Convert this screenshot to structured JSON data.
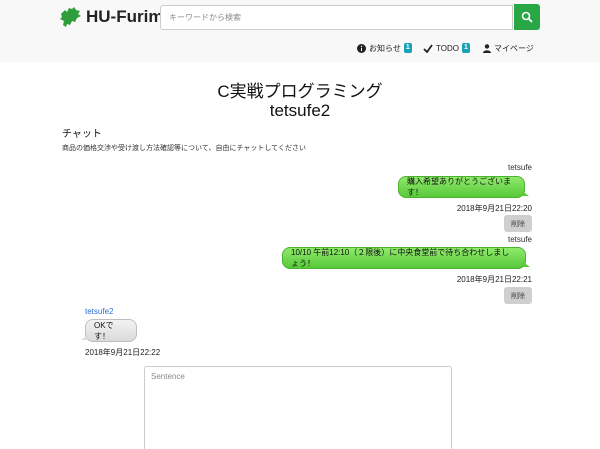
{
  "header": {
    "logo_text": "HU-Furima",
    "search": {
      "placeholder": "キーワードから検索",
      "value": ""
    },
    "nav": {
      "notice_label": "お知らせ",
      "notice_count": "1",
      "todo_label": "TODO",
      "todo_count": "1",
      "mypage_label": "マイページ"
    },
    "colors": {
      "search_button": "#28a745",
      "badge": "#17a2b8"
    }
  },
  "page": {
    "title": "C実戦プログラミング",
    "subtitle": "tetsufe2",
    "section_title": "チャット",
    "section_desc": "商品の価格交渉や受け渡し方法確認等について、自由にチャットしてください"
  },
  "messages": [
    {
      "sender": "tetsufe",
      "text": "購入希望ありがとうございます！",
      "time": "2018年9月21日22:20",
      "delete_label": "削除"
    },
    {
      "sender": "tetsufe",
      "text": "10/10 午前12:10（２限後）に中央食堂前で待ち合わせしましょう！",
      "time": "2018年9月21日22:21",
      "delete_label": "削除"
    },
    {
      "sender": "tetsufe2",
      "text": "OKです！",
      "time": "2018年9月21日22:22"
    }
  ],
  "composer": {
    "placeholder": "Sentence"
  }
}
